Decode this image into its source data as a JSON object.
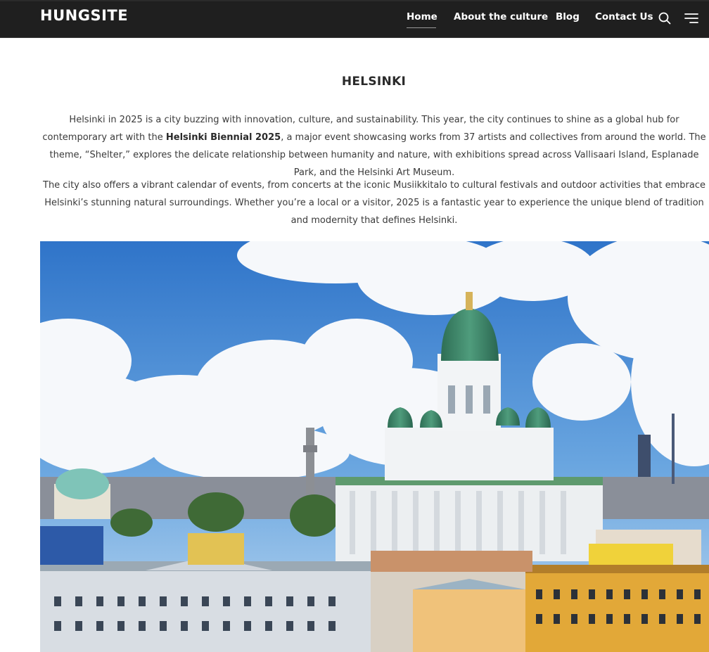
{
  "header": {
    "brand": "HUNGSITE",
    "nav": {
      "home": "Home",
      "about": "About the culture",
      "blog": "Blog",
      "contact": "Contact Us"
    },
    "active_item": "Home",
    "icons": [
      "search-icon",
      "hamburger-menu-icon"
    ]
  },
  "main": {
    "title": "HELSINKI",
    "paragraph1": {
      "text_before": "Helsinki in 2025 is a city buzzing with innovation, culture, and sustainability. This year, the city continues to shine as a global hub for contemporary art with the ",
      "bold": "Helsinki Biennial 2025",
      "text_after": ", a major event showcasing works from 37 artists and collectives from around the world. The theme, “Shelter,” explores the delicate relationship between humanity and nature, with exhibitions spread across Vallisaari Island, Esplanade Park, and the Helsinki Art Museum."
    },
    "paragraph2": "The city also offers a vibrant calendar of events, from concerts at the iconic Musiikkitalo to cultural festivals and outdoor activities that embrace Helsinki’s stunning natural surroundings. Whether you’re a local or a visitor, 2025 is a fantastic year to experience the unique blend of tradition and modernity that defines Helsinki.",
    "hero_image": "helsinki-cathedral-photo"
  },
  "colors": {
    "navbar_bg": "#1f1f1f",
    "nav_text": "#ffffff",
    "body_text": "#3a3a3a",
    "sky": "#3f86d4",
    "dome_green": "#3f8a6a"
  }
}
